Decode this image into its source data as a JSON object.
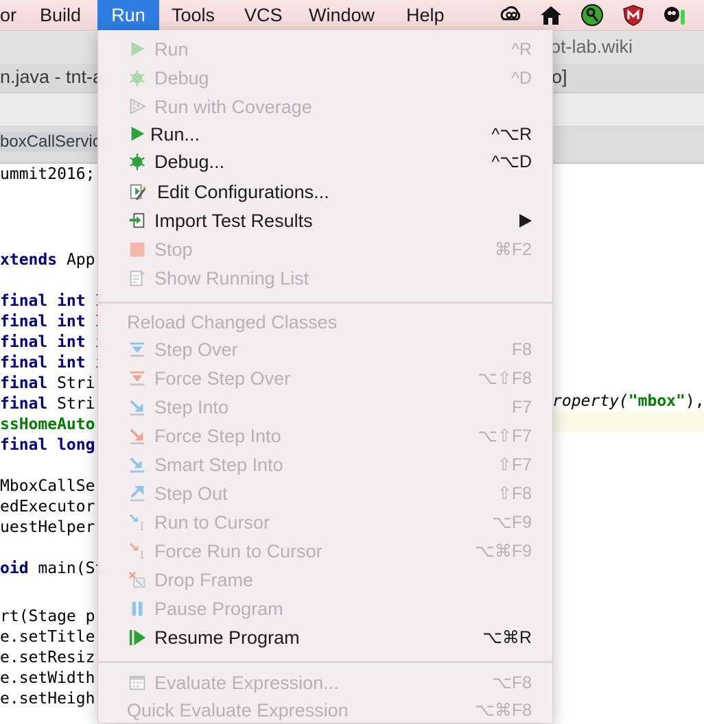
{
  "menubar": {
    "items": [
      "or",
      "Build",
      "Run",
      "Tools",
      "VCS",
      "Window",
      "Help"
    ],
    "active_index": 2,
    "accent": "#2f7de1"
  },
  "ide": {
    "project_tab": "ot-lab.wiki",
    "window_title_left": "n.java - tnt-a",
    "window_title_right": "o]",
    "editor_tab": "boxCallServic",
    "code_lines": [
      {
        "k": "",
        "t": "ummit2016;"
      },
      {
        "k": "kw",
        "t": "xtends",
        "r": " App"
      },
      {
        "k": "kw",
        "t": "final int",
        "r": " I"
      },
      {
        "k": "kw",
        "t": "final int",
        "r": " I"
      },
      {
        "k": "kw",
        "t": "final int",
        "r": " i"
      },
      {
        "k": "kw",
        "t": "final int",
        "r": " i"
      },
      {
        "k": "kw",
        "t": "final",
        "r": " Stri"
      },
      {
        "k": "kw",
        "t": "final",
        "r": " Stri"
      },
      {
        "k": "ann",
        "t": "ssHomeAuto"
      },
      {
        "k": "kw",
        "t": "final long"
      },
      {
        "k": "",
        "t": "MboxCallSe"
      },
      {
        "k": "",
        "t": "edExecutor"
      },
      {
        "k": "",
        "t": "uestHelper"
      },
      {
        "k": "kw",
        "t": "oid",
        "r": " main(St"
      },
      {
        "k": "",
        "t": "rt(Stage p"
      },
      {
        "k": "",
        "t": "e.setTitle"
      },
      {
        "k": "",
        "t": "e.setResiz"
      },
      {
        "k": "",
        "t": "e.setWidth"
      },
      {
        "k": "",
        "t": "e.setHeigh"
      }
    ],
    "code_right_prefix": "roperty(",
    "code_right_string": "\"mbox\"",
    "code_right_suffix": "),"
  },
  "menu": {
    "items": [
      {
        "label": "Run",
        "shortcut": "^R",
        "enabled": false,
        "icon": "run-icon"
      },
      {
        "label": "Debug",
        "shortcut": "^D",
        "enabled": false,
        "icon": "debug-bug-icon"
      },
      {
        "label": "Run with Coverage",
        "shortcut": "",
        "enabled": false,
        "icon": "coverage-icon"
      },
      {
        "label": "Run...",
        "shortcut": "^⌥R",
        "enabled": true,
        "icon": "run-icon"
      },
      {
        "label": "Debug...",
        "shortcut": "^⌥D",
        "enabled": true,
        "icon": "debug-bug-icon"
      },
      {
        "label": "Edit Configurations...",
        "shortcut": "",
        "enabled": true,
        "icon": "edit-configurations-icon"
      },
      {
        "label": "Import Test Results",
        "shortcut": "",
        "enabled": true,
        "submenu": true,
        "icon": "import-test-results-icon"
      },
      {
        "label": "Stop",
        "shortcut": "⌘F2",
        "enabled": false,
        "icon": "stop-icon"
      },
      {
        "label": "Show Running List",
        "shortcut": "",
        "enabled": false,
        "icon": "running-list-icon"
      },
      {
        "label": "Reload Changed Classes",
        "shortcut": "",
        "enabled": false,
        "icon": ""
      },
      {
        "label": "Step Over",
        "shortcut": "F8",
        "enabled": false,
        "icon": "step-over-icon"
      },
      {
        "label": "Force Step Over",
        "shortcut": "⌥⇧F8",
        "enabled": false,
        "icon": "force-step-over-icon"
      },
      {
        "label": "Step Into",
        "shortcut": "F7",
        "enabled": false,
        "icon": "step-into-icon"
      },
      {
        "label": "Force Step Into",
        "shortcut": "⌥⇧F7",
        "enabled": false,
        "icon": "force-step-into-icon"
      },
      {
        "label": "Smart Step Into",
        "shortcut": "⇧F7",
        "enabled": false,
        "icon": "smart-step-into-icon"
      },
      {
        "label": "Step Out",
        "shortcut": "⇧F8",
        "enabled": false,
        "icon": "step-out-icon"
      },
      {
        "label": "Run to Cursor",
        "shortcut": "⌥F9",
        "enabled": false,
        "icon": "run-to-cursor-icon"
      },
      {
        "label": "Force Run to Cursor",
        "shortcut": "⌥⌘F9",
        "enabled": false,
        "icon": "force-run-to-cursor-icon"
      },
      {
        "label": "Drop Frame",
        "shortcut": "",
        "enabled": false,
        "icon": "drop-frame-icon"
      },
      {
        "label": "Pause Program",
        "shortcut": "",
        "enabled": false,
        "icon": "pause-icon"
      },
      {
        "label": "Resume Program",
        "shortcut": "⌥⌘R",
        "enabled": true,
        "icon": "resume-icon"
      },
      {
        "label": "Evaluate Expression...",
        "shortcut": "⌥F8",
        "enabled": false,
        "icon": "evaluate-expression-icon"
      },
      {
        "label": "Quick Evaluate Expression",
        "shortcut": "⌥⌘F8",
        "enabled": false,
        "icon": ""
      }
    ]
  }
}
